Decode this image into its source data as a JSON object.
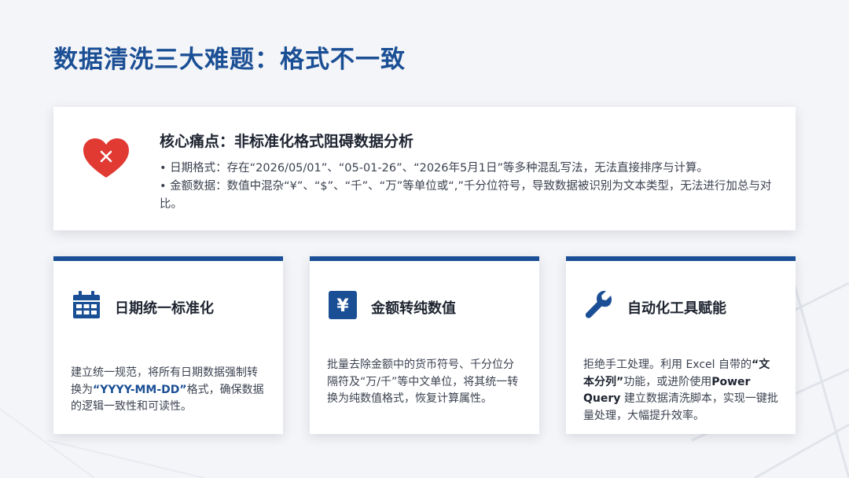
{
  "page": {
    "title": "数据清洗三大难题：格式不一致"
  },
  "pain_point": {
    "icon": "broken-heart-icon",
    "title": "核心痛点：非标准化格式阻碍数据分析",
    "bullets": [
      "• 日期格式：存在“2026/05/01”、“05-01-26”、“2026年5月1日”等多种混乱写法，无法直接排序与计算。",
      "• 金额数据：数值中混杂“¥”、“$”、“千”、“万”等单位或“,”千分位符号，导致数据被识别为文本类型，无法进行加总与对比。"
    ]
  },
  "cards": [
    {
      "icon": "calendar-icon",
      "title": "日期统一标准化",
      "desc_1": "建立统一规范，将所有日期数据强制转换为",
      "desc_highlight": "“YYYY-MM-DD”",
      "desc_2": "格式，确保数据的逻辑一致性和可读性。"
    },
    {
      "icon": "yen-icon",
      "icon_glyph": "¥",
      "title": "金额转纯数值",
      "desc": "批量去除金额中的货币符号、千分位分隔符及“万/千”等中文单位，将其统一转换为纯数值格式，恢复计算属性。"
    },
    {
      "icon": "wrench-icon",
      "title": "自动化工具赋能",
      "desc_1": "拒绝手工处理。利用 Excel 自带的",
      "desc_highlight": "“文本分列”",
      "desc_2": "功能，或进阶使用",
      "desc_bold": "Power Query",
      "desc_3": " 建立数据清洗脚本，实现一键批量处理，大幅提升效率。"
    }
  ],
  "colors": {
    "accent": "#1b4f95",
    "danger": "#e03a33",
    "background": "#f4f5f8",
    "card": "#ffffff"
  }
}
